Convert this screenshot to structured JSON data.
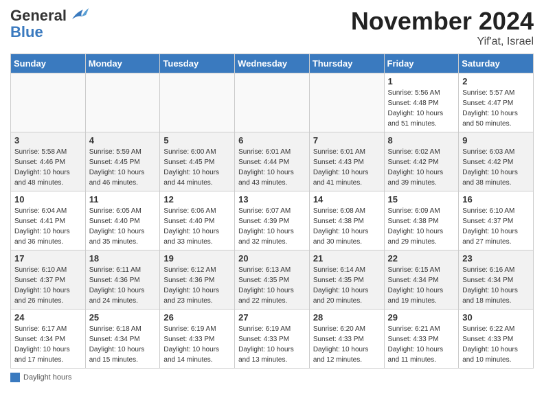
{
  "header": {
    "logo_general": "General",
    "logo_blue": "Blue",
    "title": "November 2024",
    "location": "Yif'at, Israel"
  },
  "weekdays": [
    "Sunday",
    "Monday",
    "Tuesday",
    "Wednesday",
    "Thursday",
    "Friday",
    "Saturday"
  ],
  "weeks": [
    [
      {
        "day": "",
        "info": ""
      },
      {
        "day": "",
        "info": ""
      },
      {
        "day": "",
        "info": ""
      },
      {
        "day": "",
        "info": ""
      },
      {
        "day": "",
        "info": ""
      },
      {
        "day": "1",
        "info": "Sunrise: 5:56 AM\nSunset: 4:48 PM\nDaylight: 10 hours\nand 51 minutes."
      },
      {
        "day": "2",
        "info": "Sunrise: 5:57 AM\nSunset: 4:47 PM\nDaylight: 10 hours\nand 50 minutes."
      }
    ],
    [
      {
        "day": "3",
        "info": "Sunrise: 5:58 AM\nSunset: 4:46 PM\nDaylight: 10 hours\nand 48 minutes."
      },
      {
        "day": "4",
        "info": "Sunrise: 5:59 AM\nSunset: 4:45 PM\nDaylight: 10 hours\nand 46 minutes."
      },
      {
        "day": "5",
        "info": "Sunrise: 6:00 AM\nSunset: 4:45 PM\nDaylight: 10 hours\nand 44 minutes."
      },
      {
        "day": "6",
        "info": "Sunrise: 6:01 AM\nSunset: 4:44 PM\nDaylight: 10 hours\nand 43 minutes."
      },
      {
        "day": "7",
        "info": "Sunrise: 6:01 AM\nSunset: 4:43 PM\nDaylight: 10 hours\nand 41 minutes."
      },
      {
        "day": "8",
        "info": "Sunrise: 6:02 AM\nSunset: 4:42 PM\nDaylight: 10 hours\nand 39 minutes."
      },
      {
        "day": "9",
        "info": "Sunrise: 6:03 AM\nSunset: 4:42 PM\nDaylight: 10 hours\nand 38 minutes."
      }
    ],
    [
      {
        "day": "10",
        "info": "Sunrise: 6:04 AM\nSunset: 4:41 PM\nDaylight: 10 hours\nand 36 minutes."
      },
      {
        "day": "11",
        "info": "Sunrise: 6:05 AM\nSunset: 4:40 PM\nDaylight: 10 hours\nand 35 minutes."
      },
      {
        "day": "12",
        "info": "Sunrise: 6:06 AM\nSunset: 4:40 PM\nDaylight: 10 hours\nand 33 minutes."
      },
      {
        "day": "13",
        "info": "Sunrise: 6:07 AM\nSunset: 4:39 PM\nDaylight: 10 hours\nand 32 minutes."
      },
      {
        "day": "14",
        "info": "Sunrise: 6:08 AM\nSunset: 4:38 PM\nDaylight: 10 hours\nand 30 minutes."
      },
      {
        "day": "15",
        "info": "Sunrise: 6:09 AM\nSunset: 4:38 PM\nDaylight: 10 hours\nand 29 minutes."
      },
      {
        "day": "16",
        "info": "Sunrise: 6:10 AM\nSunset: 4:37 PM\nDaylight: 10 hours\nand 27 minutes."
      }
    ],
    [
      {
        "day": "17",
        "info": "Sunrise: 6:10 AM\nSunset: 4:37 PM\nDaylight: 10 hours\nand 26 minutes."
      },
      {
        "day": "18",
        "info": "Sunrise: 6:11 AM\nSunset: 4:36 PM\nDaylight: 10 hours\nand 24 minutes."
      },
      {
        "day": "19",
        "info": "Sunrise: 6:12 AM\nSunset: 4:36 PM\nDaylight: 10 hours\nand 23 minutes."
      },
      {
        "day": "20",
        "info": "Sunrise: 6:13 AM\nSunset: 4:35 PM\nDaylight: 10 hours\nand 22 minutes."
      },
      {
        "day": "21",
        "info": "Sunrise: 6:14 AM\nSunset: 4:35 PM\nDaylight: 10 hours\nand 20 minutes."
      },
      {
        "day": "22",
        "info": "Sunrise: 6:15 AM\nSunset: 4:34 PM\nDaylight: 10 hours\nand 19 minutes."
      },
      {
        "day": "23",
        "info": "Sunrise: 6:16 AM\nSunset: 4:34 PM\nDaylight: 10 hours\nand 18 minutes."
      }
    ],
    [
      {
        "day": "24",
        "info": "Sunrise: 6:17 AM\nSunset: 4:34 PM\nDaylight: 10 hours\nand 17 minutes."
      },
      {
        "day": "25",
        "info": "Sunrise: 6:18 AM\nSunset: 4:34 PM\nDaylight: 10 hours\nand 15 minutes."
      },
      {
        "day": "26",
        "info": "Sunrise: 6:19 AM\nSunset: 4:33 PM\nDaylight: 10 hours\nand 14 minutes."
      },
      {
        "day": "27",
        "info": "Sunrise: 6:19 AM\nSunset: 4:33 PM\nDaylight: 10 hours\nand 13 minutes."
      },
      {
        "day": "28",
        "info": "Sunrise: 6:20 AM\nSunset: 4:33 PM\nDaylight: 10 hours\nand 12 minutes."
      },
      {
        "day": "29",
        "info": "Sunrise: 6:21 AM\nSunset: 4:33 PM\nDaylight: 10 hours\nand 11 minutes."
      },
      {
        "day": "30",
        "info": "Sunrise: 6:22 AM\nSunset: 4:33 PM\nDaylight: 10 hours\nand 10 minutes."
      }
    ]
  ],
  "footer": {
    "legend_label": "Daylight hours"
  }
}
